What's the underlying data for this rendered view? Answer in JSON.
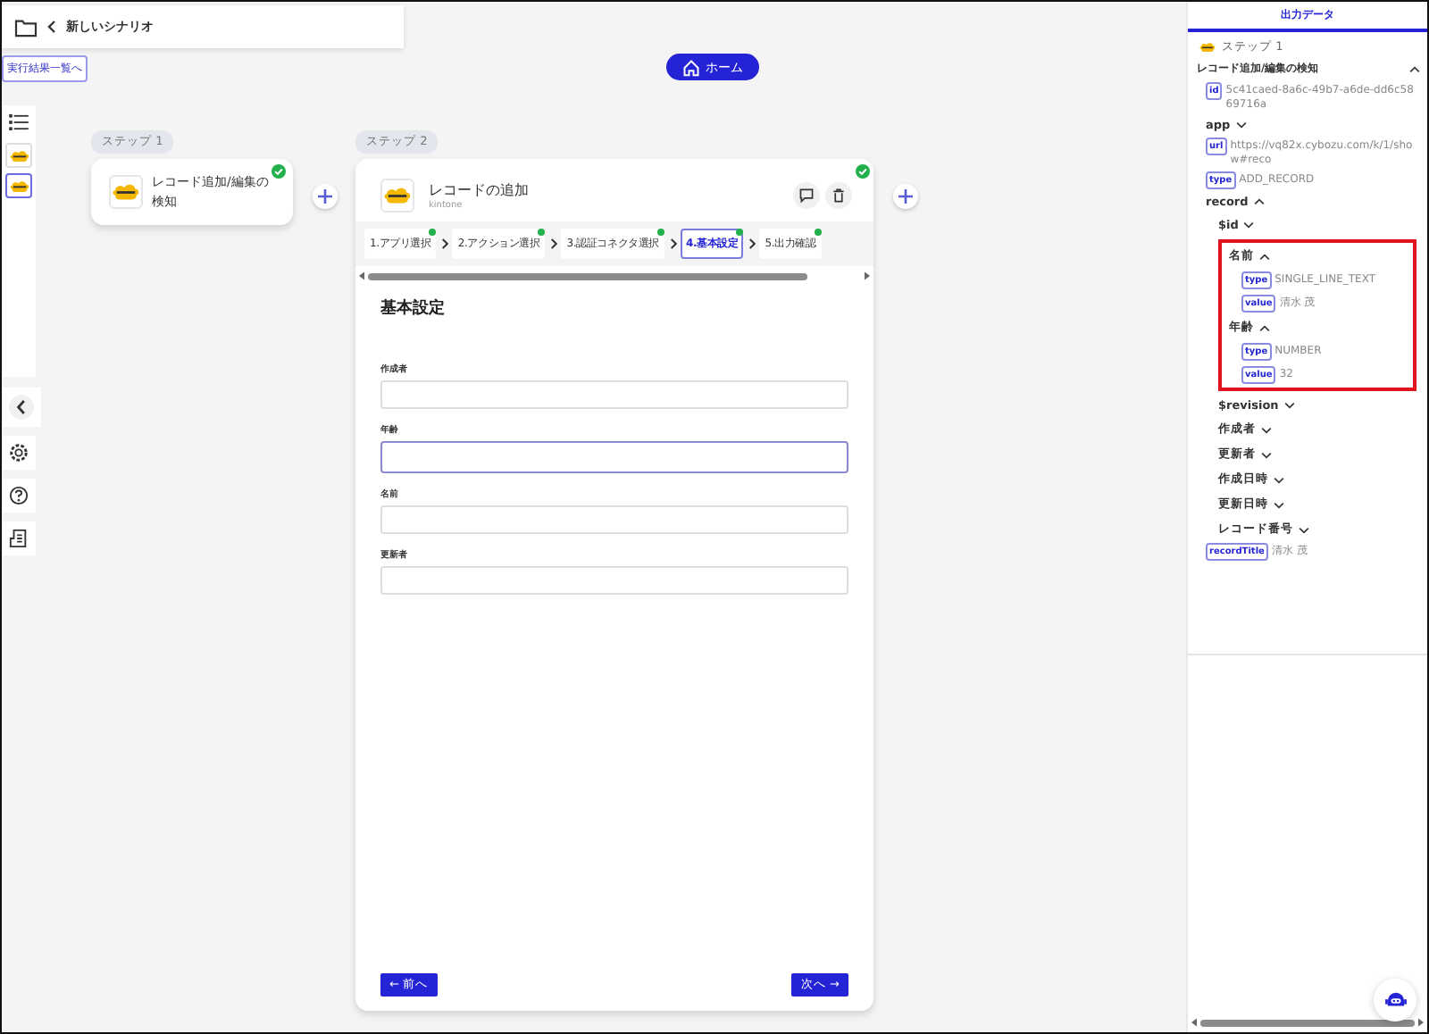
{
  "header": {
    "title": "新しいシナリオ"
  },
  "results_link": "実行結果一覧へ",
  "home_button": "ホーム",
  "sidebar": {
    "steps": [
      {
        "selected": false
      },
      {
        "selected": true
      }
    ]
  },
  "steps": [
    {
      "label": "ステップ 1",
      "title": "レコード追加/編集の検知",
      "done": true
    },
    {
      "label": "ステップ 2",
      "title": "レコードの追加",
      "subtitle": "kintone",
      "done": true,
      "tabs": [
        {
          "label": "1.アプリ選択",
          "done": true,
          "selected": false
        },
        {
          "label": "2.アクション選択",
          "done": true,
          "selected": false
        },
        {
          "label": "3.認証コネクタ選択",
          "done": true,
          "selected": false
        },
        {
          "label": "4.基本設定",
          "done": true,
          "selected": true
        },
        {
          "label": "5.出力確認",
          "done": true,
          "selected": false
        }
      ],
      "section_title": "基本設定",
      "fields": [
        {
          "label": "作成者",
          "focused": false
        },
        {
          "label": "年齢",
          "focused": true
        },
        {
          "label": "名前",
          "focused": false
        },
        {
          "label": "更新者",
          "focused": false
        }
      ],
      "prev_button": "← 前へ",
      "next_button": "次へ →"
    }
  ],
  "output_panel": {
    "tab": "出力データ",
    "step_label": "ステップ 1",
    "title": "レコード追加/編集の検知",
    "tree": [
      {
        "kind": "value",
        "key": "id",
        "value": "5c41caed-8a6c-49b7-a6de-dd6c5869716a"
      },
      {
        "kind": "group",
        "name": "app",
        "expanded": false
      },
      {
        "kind": "value",
        "key": "url",
        "value": "https://vq82x.cybozu.com/k/1/show#reco"
      },
      {
        "kind": "value",
        "key": "type",
        "value": "ADD_RECORD"
      },
      {
        "kind": "group",
        "name": "record",
        "expanded": true,
        "children": [
          {
            "kind": "group",
            "name": "$id",
            "expanded": false
          },
          {
            "kind": "group",
            "name": "名前",
            "expanded": true,
            "highlighted": true,
            "children": [
              {
                "kind": "value",
                "key": "type",
                "value": "SINGLE_LINE_TEXT"
              },
              {
                "kind": "value",
                "key": "value",
                "value": "清水 茂"
              }
            ]
          },
          {
            "kind": "group",
            "name": "年齢",
            "expanded": true,
            "highlighted": true,
            "children": [
              {
                "kind": "value",
                "key": "type",
                "value": "NUMBER"
              },
              {
                "kind": "value",
                "key": "value",
                "value": "32"
              }
            ]
          },
          {
            "kind": "group",
            "name": "$revision",
            "expanded": false
          },
          {
            "kind": "group",
            "name": "作成者",
            "expanded": false
          },
          {
            "kind": "group",
            "name": "更新者",
            "expanded": false
          },
          {
            "kind": "group",
            "name": "作成日時",
            "expanded": false
          },
          {
            "kind": "group",
            "name": "更新日時",
            "expanded": false
          },
          {
            "kind": "group",
            "name": "レコード番号",
            "expanded": false
          }
        ]
      },
      {
        "kind": "value",
        "key": "recordTitle",
        "value": "清水 茂"
      }
    ]
  }
}
